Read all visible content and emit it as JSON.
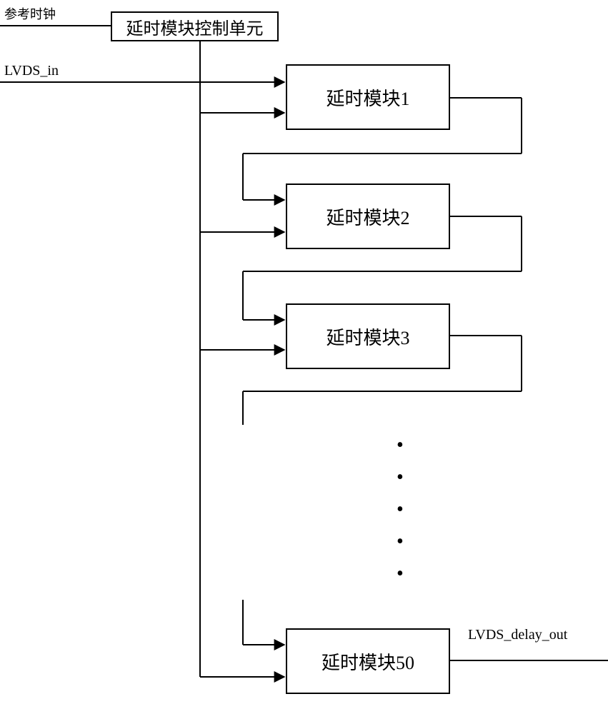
{
  "labels": {
    "refClock": "参考时钟",
    "lvdsIn": "LVDS_in",
    "lvdsDelayOut": "LVDS_delay_out"
  },
  "controlUnit": "延时模块控制单元",
  "modules": {
    "m1": "延时模块1",
    "m2": "延时模块2",
    "m3": "延时模块3",
    "m50": "延时模块50"
  }
}
